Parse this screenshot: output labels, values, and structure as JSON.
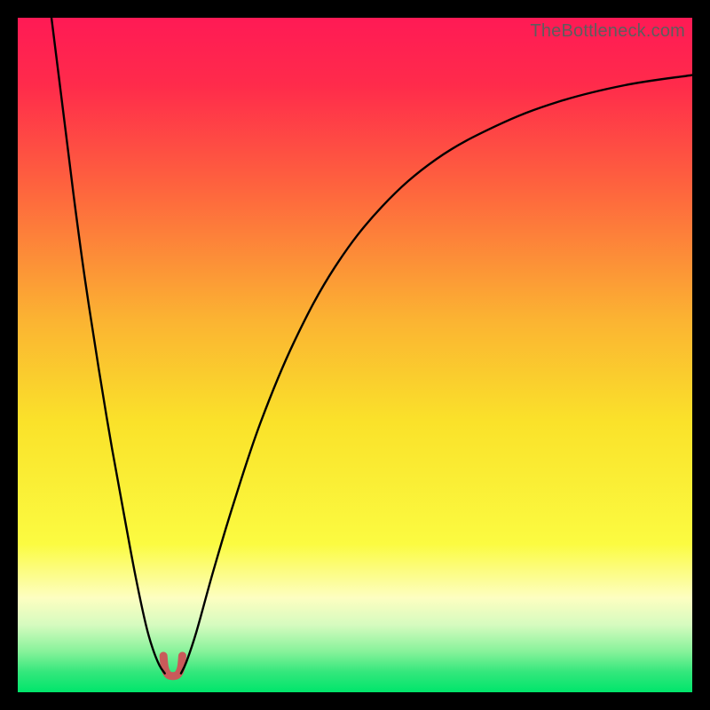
{
  "watermark": "TheBottleneck.com",
  "chart_data": {
    "type": "line",
    "title": "",
    "xlabel": "",
    "ylabel": "",
    "xlim": [
      0,
      100
    ],
    "ylim": [
      0,
      100
    ],
    "background_gradient": {
      "stops": [
        {
          "offset": 0.0,
          "color": "#ff1a55"
        },
        {
          "offset": 0.1,
          "color": "#ff2b4b"
        },
        {
          "offset": 0.25,
          "color": "#fe633e"
        },
        {
          "offset": 0.45,
          "color": "#fbb432"
        },
        {
          "offset": 0.6,
          "color": "#fae22a"
        },
        {
          "offset": 0.78,
          "color": "#fbfb41"
        },
        {
          "offset": 0.86,
          "color": "#fdfec1"
        },
        {
          "offset": 0.9,
          "color": "#d6fbbf"
        },
        {
          "offset": 0.94,
          "color": "#86f29a"
        },
        {
          "offset": 0.97,
          "color": "#34e77c"
        },
        {
          "offset": 1.0,
          "color": "#00e56b"
        }
      ]
    },
    "series": [
      {
        "name": "left-branch",
        "stroke": "#000000",
        "stroke_width": 2.4,
        "points": [
          {
            "x": 5.0,
            "y": 100.0
          },
          {
            "x": 6.0,
            "y": 92.0
          },
          {
            "x": 7.0,
            "y": 84.0
          },
          {
            "x": 8.5,
            "y": 72.0
          },
          {
            "x": 10.0,
            "y": 61.0
          },
          {
            "x": 12.0,
            "y": 48.0
          },
          {
            "x": 14.0,
            "y": 36.0
          },
          {
            "x": 16.0,
            "y": 25.0
          },
          {
            "x": 17.5,
            "y": 17.0
          },
          {
            "x": 19.0,
            "y": 10.0
          },
          {
            "x": 20.0,
            "y": 6.5
          },
          {
            "x": 21.0,
            "y": 4.0
          },
          {
            "x": 21.8,
            "y": 2.8
          }
        ]
      },
      {
        "name": "right-branch",
        "stroke": "#000000",
        "stroke_width": 2.4,
        "points": [
          {
            "x": 24.2,
            "y": 2.8
          },
          {
            "x": 25.0,
            "y": 4.5
          },
          {
            "x": 26.5,
            "y": 9.0
          },
          {
            "x": 29.0,
            "y": 18.0
          },
          {
            "x": 32.0,
            "y": 28.0
          },
          {
            "x": 36.0,
            "y": 40.0
          },
          {
            "x": 41.0,
            "y": 52.0
          },
          {
            "x": 47.0,
            "y": 63.0
          },
          {
            "x": 54.0,
            "y": 72.0
          },
          {
            "x": 62.0,
            "y": 79.0
          },
          {
            "x": 71.0,
            "y": 84.0
          },
          {
            "x": 80.0,
            "y": 87.5
          },
          {
            "x": 90.0,
            "y": 90.0
          },
          {
            "x": 100.0,
            "y": 91.5
          }
        ]
      }
    ],
    "floor_marker": {
      "stroke": "#c95a5a",
      "stroke_width": 9,
      "points": [
        {
          "x": 21.6,
          "y": 5.4
        },
        {
          "x": 21.8,
          "y": 3.6
        },
        {
          "x": 22.3,
          "y": 2.6
        },
        {
          "x": 23.0,
          "y": 2.4
        },
        {
          "x": 23.7,
          "y": 2.6
        },
        {
          "x": 24.2,
          "y": 3.6
        },
        {
          "x": 24.4,
          "y": 5.4
        }
      ]
    }
  }
}
